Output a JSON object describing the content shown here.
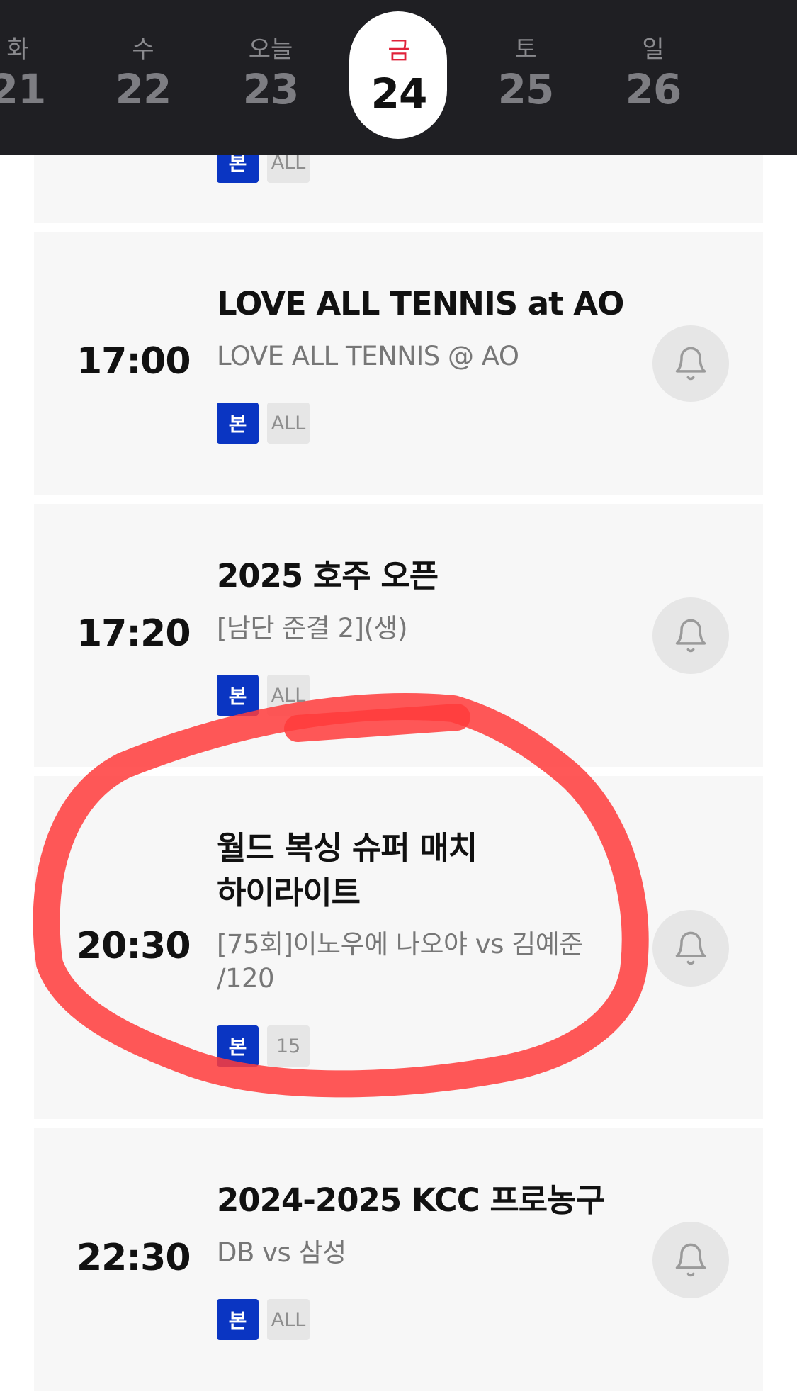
{
  "date_strip": {
    "days": [
      {
        "dow": "화",
        "num": "21"
      },
      {
        "dow": "수",
        "num": "22"
      },
      {
        "dow": "오늘",
        "num": "23"
      },
      {
        "dow": "금",
        "num": "24",
        "selected": true
      },
      {
        "dow": "토",
        "num": "25"
      },
      {
        "dow": "일",
        "num": "26"
      }
    ]
  },
  "schedule": [
    {
      "time": "",
      "title": "",
      "subtitle": "",
      "badge_main": "본",
      "badge_rating": "ALL"
    },
    {
      "time": "17:00",
      "title": "LOVE ALL TENNIS at AO",
      "subtitle": "LOVE ALL TENNIS @ AO",
      "badge_main": "본",
      "badge_rating": "ALL"
    },
    {
      "time": "17:20",
      "title": "2025 호주 오픈",
      "subtitle": "[남단 준결 2](생)",
      "badge_main": "본",
      "badge_rating": "ALL"
    },
    {
      "time": "20:30",
      "title": "월드 복싱 슈퍼 매치 하이라이트",
      "title_line1": "월드 복싱 슈퍼 매치",
      "title_line2": "하이라이트",
      "subtitle_line1": "[75회]이노우에 나오야 vs 김예준",
      "subtitle_line2": "/120",
      "badge_main": "본",
      "badge_rating": "15"
    },
    {
      "time": "22:30",
      "title": "2024-2025 KCC 프로농구",
      "subtitle": "DB vs 삼성",
      "badge_main": "본",
      "badge_rating": "ALL"
    }
  ],
  "icons": {
    "bell": "bell-icon"
  },
  "colors": {
    "header_bg": "#1f1f23",
    "selected_day": "#e0233a",
    "badge_main": "#0a35c2",
    "card_bg": "#f7f7f7",
    "annotation": "#ff3b3b"
  }
}
